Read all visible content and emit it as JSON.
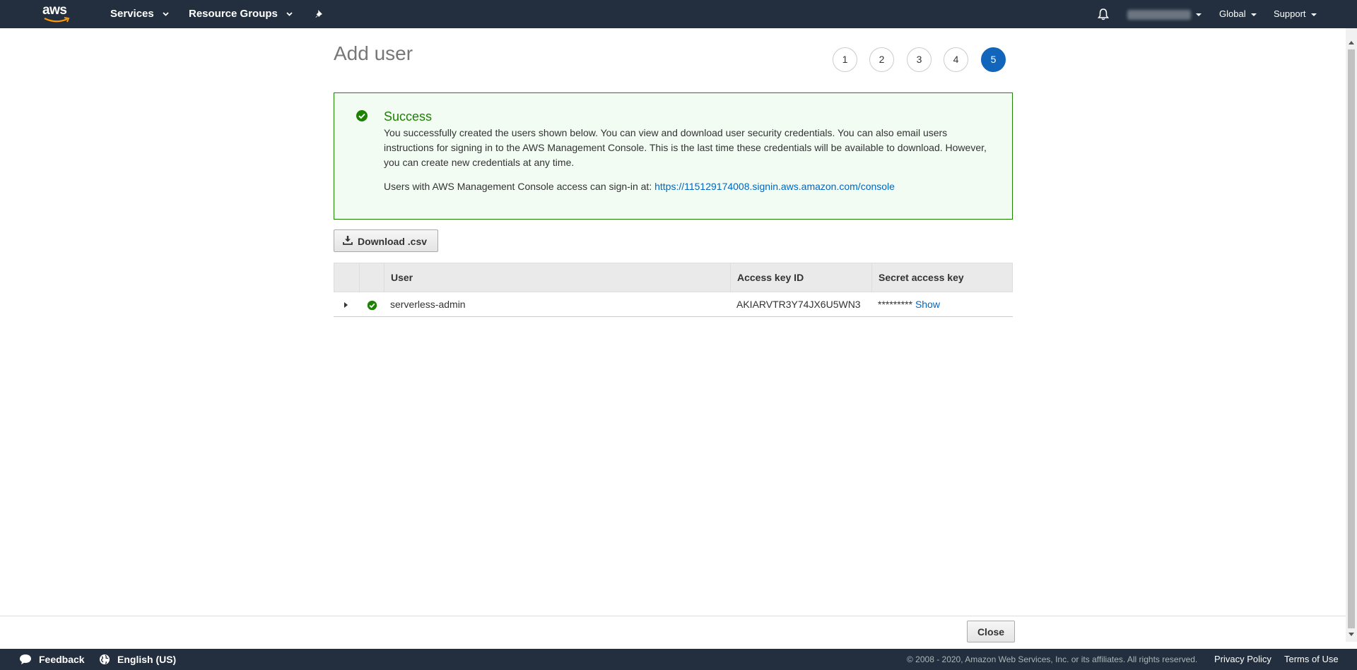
{
  "topnav": {
    "logo_text": "aws",
    "services_label": "Services",
    "resource_groups_label": "Resource Groups",
    "region_label": "Global",
    "support_label": "Support"
  },
  "page": {
    "title": "Add user",
    "steps": [
      "1",
      "2",
      "3",
      "4",
      "5"
    ],
    "active_step": "5"
  },
  "alert": {
    "title": "Success",
    "body": "You successfully created the users shown below. You can view and download user security credentials. You can also email users instructions for signing in to the AWS Management Console. This is the last time these credentials will be available to download. However, you can create new credentials at any time.",
    "signin_prefix": "Users with AWS Management Console access can sign-in at:",
    "signin_url": "https://115129174008.signin.aws.amazon.com/console"
  },
  "download_label": "Download .csv",
  "table": {
    "columns": [
      "User",
      "Access key ID",
      "Secret access key"
    ],
    "rows": [
      {
        "user": "serverless-admin",
        "access_key_id": "AKIARVTR3Y74JX6U5WN3",
        "secret_masked": "*********",
        "show_label": "Show"
      }
    ]
  },
  "close_label": "Close",
  "footer": {
    "feedback_label": "Feedback",
    "language_label": "English (US)",
    "copyright": "© 2008 - 2020, Amazon Web Services, Inc. or its affiliates. All rights reserved.",
    "privacy_label": "Privacy Policy",
    "terms_label": "Terms of Use"
  },
  "colors": {
    "nav_bg": "#232f3e",
    "success_green": "#1d8102",
    "active_step_blue": "#1166bb",
    "link_blue": "#0066c0"
  }
}
